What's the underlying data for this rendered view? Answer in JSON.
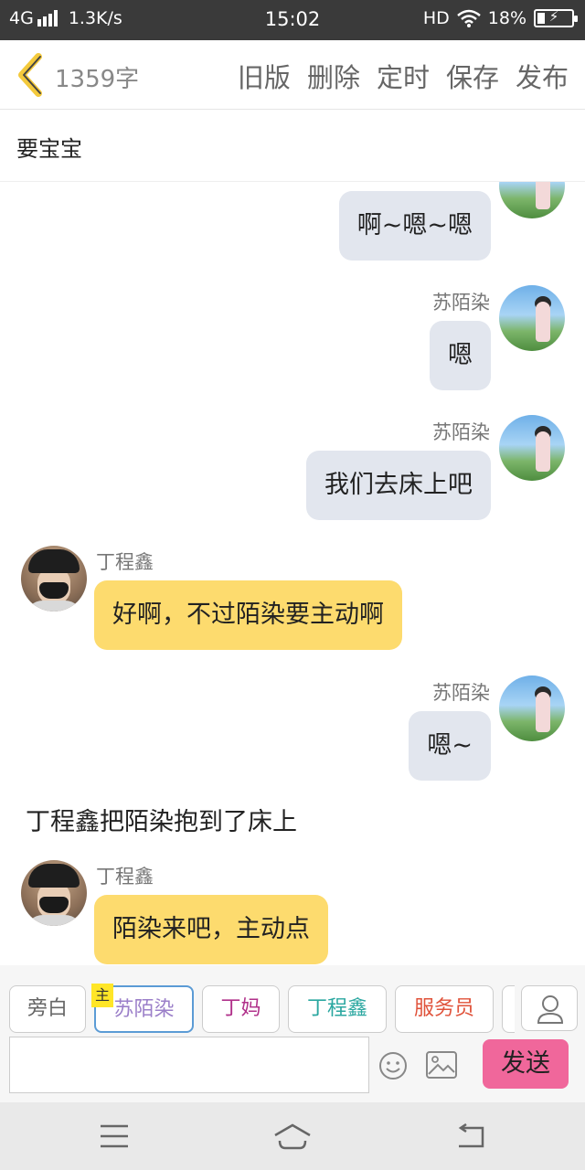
{
  "status_bar": {
    "network": "4G",
    "speed": "1.3K/s",
    "time": "15:02",
    "hd": "HD",
    "battery": "18%",
    "icons": [
      "signal-icon",
      "wifi-icon",
      "battery-icon"
    ]
  },
  "top_bar": {
    "back_icon": "chevron-left-icon",
    "word_count": "1359字",
    "actions": [
      "旧版",
      "删除",
      "定时",
      "保存",
      "发布"
    ]
  },
  "title": "要宝宝",
  "messages": [
    {
      "side": "right",
      "name": "",
      "text": "啊~嗯~嗯"
    },
    {
      "side": "right",
      "name": "苏陌染",
      "text": "嗯"
    },
    {
      "side": "right",
      "name": "苏陌染",
      "text": "我们去床上吧"
    },
    {
      "side": "left",
      "name": "丁程鑫",
      "text": "好啊，不过陌染要主动啊"
    },
    {
      "side": "right",
      "name": "苏陌染",
      "text": "嗯~"
    },
    {
      "side": "narration",
      "name": "",
      "text": "丁程鑫把陌染抱到了床上"
    },
    {
      "side": "left",
      "name": "丁程鑫",
      "text": "陌染来吧，主动点"
    }
  ],
  "role_bar": {
    "badge": "主",
    "roles": [
      {
        "label": "旁白",
        "color": "#666666"
      },
      {
        "label": "苏陌染",
        "color": "#9b7fc9"
      },
      {
        "label": "丁妈",
        "color": "#b0308a"
      },
      {
        "label": "丁程鑫",
        "color": "#2aa7a0"
      },
      {
        "label": "服务员",
        "color": "#e0523a"
      }
    ],
    "person_icon": "person-icon",
    "emoji_icon": "emoji-icon",
    "image_icon": "image-icon",
    "send_label": "发送",
    "accent": "#f0679b"
  },
  "nav_bar": {
    "icons": [
      "menu-icon",
      "home-icon",
      "back-icon"
    ]
  }
}
